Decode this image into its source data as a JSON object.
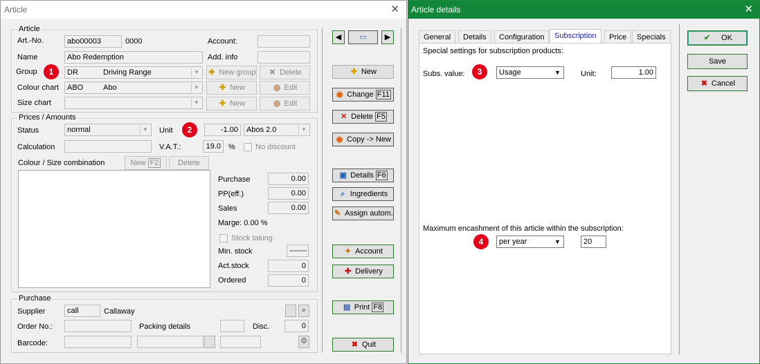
{
  "article": {
    "title": "Article",
    "article_group": {
      "legend": "Article",
      "art_no_label": "Art.-No.",
      "art_no": "abo00003",
      "art_no_suffix": "0000",
      "account_label": "Account:",
      "name_label": "Name",
      "name": "Abo Redemption",
      "add_info_label": "Add. info",
      "group_label": "Group",
      "group_code": "DR",
      "group_name": "Driving Range",
      "new_group": "New group",
      "delete": "Delete",
      "colour_chart_label": "Colour chart",
      "colour_code": "ABO",
      "colour_name": "Abo",
      "new": "New",
      "edit": "Edit",
      "size_chart_label": "Size chart"
    },
    "prices": {
      "legend": "Prices / Amounts",
      "status_label": "Status",
      "status": "normal",
      "unit_label": "Unit",
      "unit_value": "-1.00",
      "unit_name": "Abos 2.0",
      "calc_label": "Calculation",
      "vat_label": "V.A.T.:",
      "vat": "19.0",
      "pct": "%",
      "no_discount": "No discount",
      "combo_label": "Colour / Size combination",
      "new_f2": "New",
      "f2": "F2",
      "delete": "Delete",
      "purchase_label": "Purchase",
      "purchase": "0.00",
      "pp_label": "PP(eff.)",
      "pp": "0.00",
      "sales_label": "Sales",
      "sales": "0.00",
      "marge": "Marge: 0.00 %",
      "stock_taking": "Stock taking",
      "min_stock_label": "Min. stock",
      "min_stock": "-------",
      "act_stock_label": "Act.stock",
      "act_stock": "0",
      "ordered_label": "Ordered",
      "ordered": "0"
    },
    "purchase": {
      "legend": "Purchase",
      "supplier_label": "Supplier",
      "supplier_code": "call",
      "supplier_name": "Callaway",
      "order_no_label": "Order No.:",
      "packing_label": "Packing details",
      "disc_label": "Disc.",
      "disc": "0",
      "barcode_label": "Barcode:"
    },
    "actions": {
      "new": "New",
      "change": "Change",
      "change_key": "F11",
      "delete": "Delete",
      "delete_key": "F5",
      "copy": "Copy -> New",
      "details": "Details",
      "details_key": "F6",
      "ingredients": "Ingredients",
      "assign": "Assign autom.",
      "account": "Account",
      "delivery": "Delivery",
      "print": "Print",
      "print_key": "F8",
      "quit": "Quit"
    }
  },
  "details": {
    "title": "Article details",
    "tabs": [
      "General",
      "Details",
      "Configuration",
      "Subscription",
      "Price",
      "Specials"
    ],
    "active_tab": "Subscription",
    "intro": "Special settings for subscription products:",
    "subs_label": "Subs. value:",
    "subs_value": "Usage",
    "unit_label": "Unit:",
    "unit": "1.00",
    "max_label": "Maximum encashment of this article within the subscription:",
    "period": "per year",
    "max_value": "20",
    "ok": "OK",
    "save": "Save",
    "cancel": "Cancel"
  },
  "badges": [
    "1",
    "2",
    "3",
    "4"
  ],
  "colors": {
    "badge": "#e2001a",
    "details_titlebar": "#12873a",
    "active_tab": "#2222aa"
  }
}
